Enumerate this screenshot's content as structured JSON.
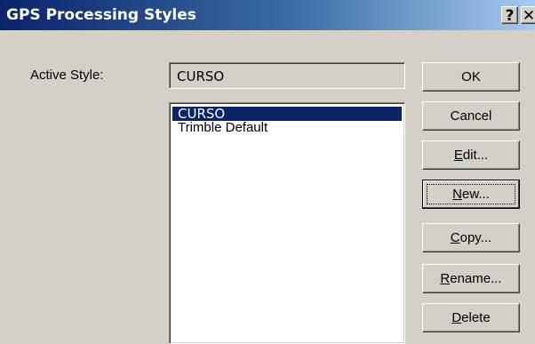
{
  "window": {
    "title": "GPS Processing Styles",
    "help_glyph": "?",
    "close_glyph": "✕"
  },
  "active_style": {
    "label": "Active Style:",
    "value": "CURSO"
  },
  "styles_list": {
    "items": [
      "CURSO",
      "Trimble Default"
    ],
    "selected_index": 0
  },
  "buttons": {
    "ok": {
      "label": "OK"
    },
    "cancel": {
      "label": "Cancel"
    },
    "edit": {
      "mnemonic": "E",
      "rest": "dit..."
    },
    "new": {
      "mnemonic": "N",
      "rest": "ew..."
    },
    "copy": {
      "mnemonic": "C",
      "rest": "opy..."
    },
    "rename": {
      "mnemonic": "R",
      "rest": "ename..."
    },
    "delete": {
      "mnemonic": "D",
      "rest": "elete"
    }
  },
  "colors": {
    "titlebar_start": "#0a246a",
    "titlebar_end": "#a6caf0",
    "selection": "#0a246a",
    "face": "#d4d0c8"
  }
}
